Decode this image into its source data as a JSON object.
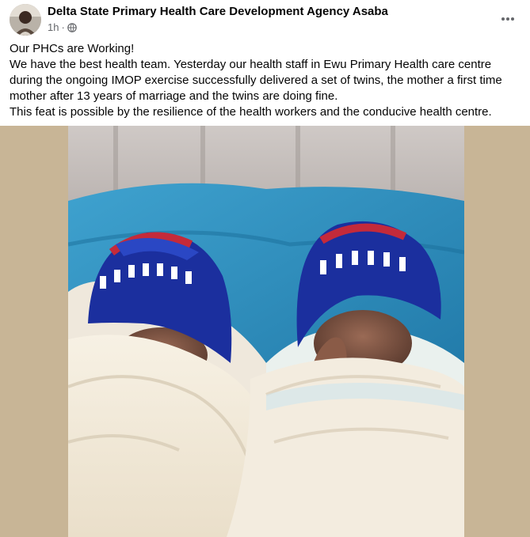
{
  "post": {
    "page_name": "Delta State Primary Health Care Development Agency Asaba",
    "time": "1h",
    "separator": "·",
    "icons": {
      "privacy": "globe-icon",
      "more": "more-horizontal-icon"
    },
    "paragraphs": [
      "Our PHCs are Working!",
      "We have the best health team. Yesterday our health staff in Ewu Primary Health care centre during the ongoing IMOP exercise successfully delivered a set of twins, the mother a first time mother after 13 years of marriage and the twins are doing fine.",
      "This feat is possible by the resilience of the health workers and the conducive health centre."
    ]
  },
  "colors": {
    "name_text": "#050505",
    "meta_text": "#65676b",
    "photo_side_bg": "#c8b596",
    "blanket_blue": "#2f8fbd",
    "beanie_blue": "#1b2f9e",
    "beanie_red": "#c42a3a"
  }
}
